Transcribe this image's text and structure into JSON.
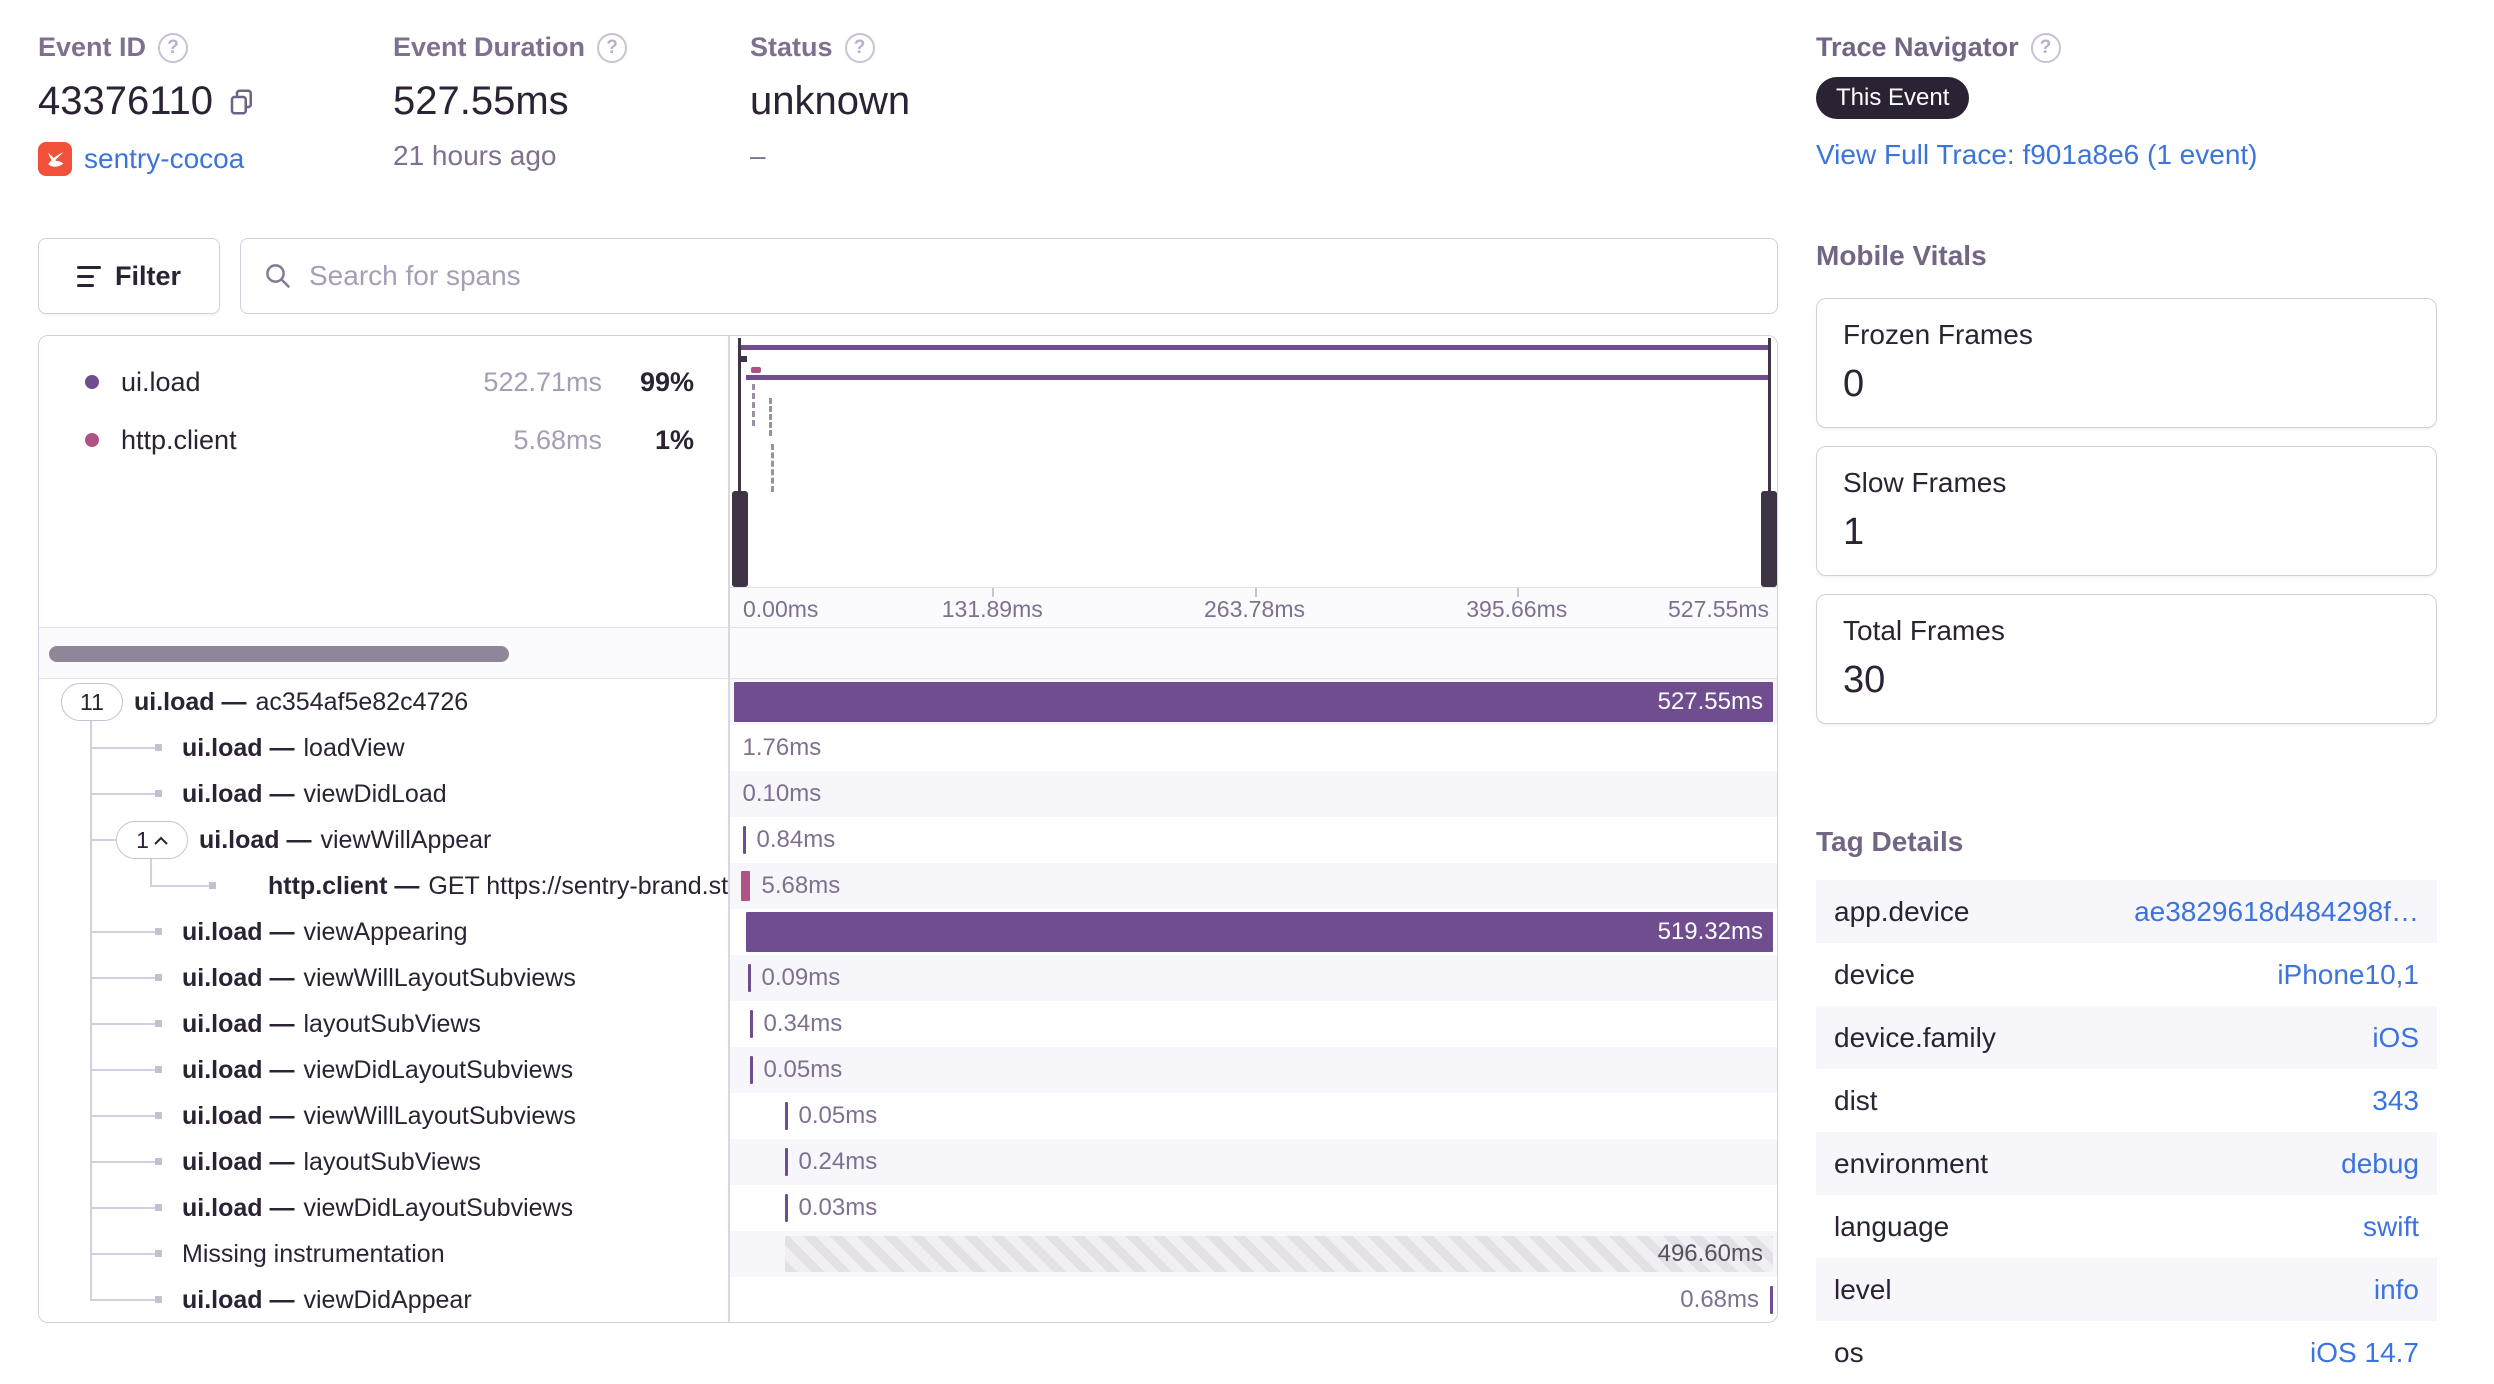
{
  "header": {
    "event_id": {
      "label": "Event ID",
      "value": "43376110",
      "project": "sentry-cocoa"
    },
    "event_duration": {
      "label": "Event Duration",
      "value": "527.55ms",
      "ago": "21 hours ago"
    },
    "status": {
      "label": "Status",
      "value": "unknown",
      "sub": "–"
    },
    "trace_navigator": {
      "label": "Trace Navigator",
      "badge": "This Event",
      "link": "View Full Trace: f901a8e6 (1 event)"
    }
  },
  "toolbar": {
    "filter_label": "Filter",
    "search_placeholder": "Search for spans"
  },
  "minimap": {
    "legend": [
      {
        "name": "ui.load",
        "duration": "522.71ms",
        "pct": "99%",
        "color": "#6F4D8F"
      },
      {
        "name": "http.client",
        "duration": "5.68ms",
        "pct": "1%",
        "color": "#AF5285"
      }
    ],
    "axis": [
      "0.00ms",
      "131.89ms",
      "263.78ms",
      "395.66ms",
      "527.55ms"
    ]
  },
  "span_tree": {
    "root_badge": "11",
    "collapsed_badge": "1",
    "rows": [
      {
        "op": "ui.load —",
        "name": "ac354af5e82c4726",
        "dur": "527.55ms"
      },
      {
        "op": "ui.load —",
        "name": "loadView",
        "dur": "1.76ms"
      },
      {
        "op": "ui.load —",
        "name": "viewDidLoad",
        "dur": "0.10ms"
      },
      {
        "op": "ui.load —",
        "name": "viewWillAppear",
        "dur": "0.84ms"
      },
      {
        "op": "http.client —",
        "name": "GET https://sentry-brand.stora",
        "dur": "5.68ms"
      },
      {
        "op": "ui.load —",
        "name": "viewAppearing",
        "dur": "519.32ms"
      },
      {
        "op": "ui.load —",
        "name": "viewWillLayoutSubviews",
        "dur": "0.09ms"
      },
      {
        "op": "ui.load —",
        "name": "layoutSubViews",
        "dur": "0.34ms"
      },
      {
        "op": "ui.load —",
        "name": "viewDidLayoutSubviews",
        "dur": "0.05ms"
      },
      {
        "op": "ui.load —",
        "name": "viewWillLayoutSubviews",
        "dur": "0.05ms"
      },
      {
        "op": "ui.load —",
        "name": "layoutSubViews",
        "dur": "0.24ms"
      },
      {
        "op": "ui.load —",
        "name": "viewDidLayoutSubviews",
        "dur": "0.03ms"
      },
      {
        "op": "",
        "name": "Missing instrumentation",
        "dur": "496.60ms"
      },
      {
        "op": "ui.load —",
        "name": "viewDidAppear",
        "dur": "0.68ms"
      }
    ]
  },
  "mobile_vitals": {
    "title": "Mobile Vitals",
    "cards": [
      {
        "label": "Frozen Frames",
        "value": "0"
      },
      {
        "label": "Slow Frames",
        "value": "1"
      },
      {
        "label": "Total Frames",
        "value": "30"
      }
    ]
  },
  "tag_details": {
    "title": "Tag Details",
    "rows": [
      {
        "key": "app.device",
        "value": "ae3829618d484298f…"
      },
      {
        "key": "device",
        "value": "iPhone10,1"
      },
      {
        "key": "device.family",
        "value": "iOS"
      },
      {
        "key": "dist",
        "value": "343"
      },
      {
        "key": "environment",
        "value": "debug"
      },
      {
        "key": "language",
        "value": "swift"
      },
      {
        "key": "level",
        "value": "info"
      },
      {
        "key": "os",
        "value": "iOS 14.7"
      }
    ]
  },
  "colors": {
    "span_purple": "#6F4D8F",
    "span_magenta": "#AF5285",
    "link_blue": "#3C74DD",
    "badge_bg": "#2B2233",
    "swift_orange": "#F05138"
  }
}
